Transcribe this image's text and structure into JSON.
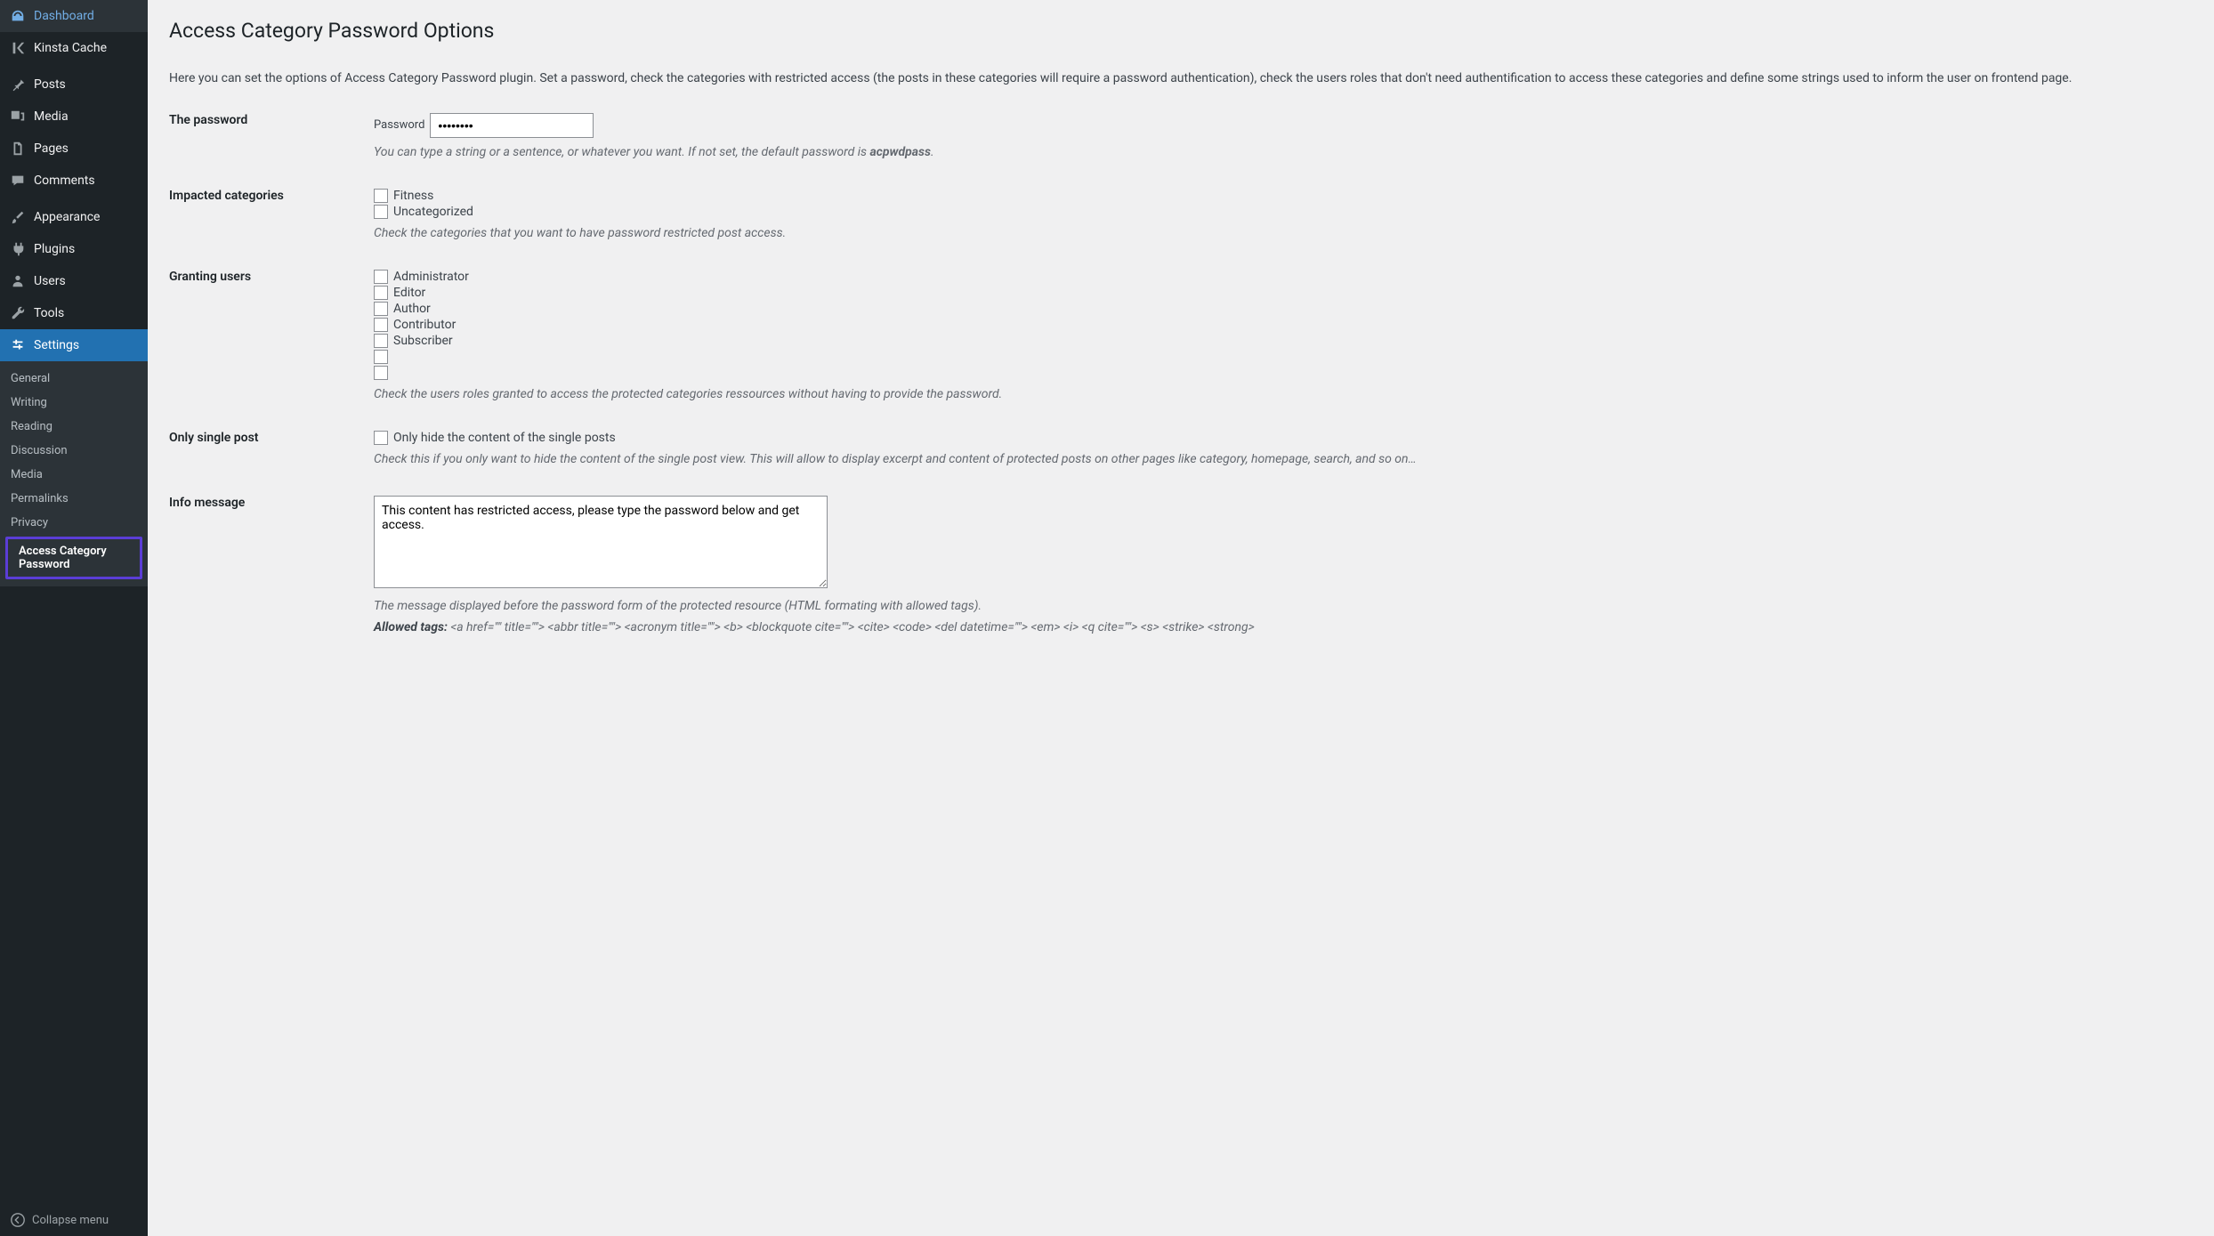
{
  "sidebar": {
    "items": [
      {
        "label": "Dashboard",
        "icon": "dashboard"
      },
      {
        "label": "Kinsta Cache",
        "icon": "kinsta"
      },
      {
        "label": "Posts",
        "icon": "pin"
      },
      {
        "label": "Media",
        "icon": "media"
      },
      {
        "label": "Pages",
        "icon": "pages"
      },
      {
        "label": "Comments",
        "icon": "comments"
      },
      {
        "label": "Appearance",
        "icon": "brush"
      },
      {
        "label": "Plugins",
        "icon": "plug"
      },
      {
        "label": "Users",
        "icon": "user"
      },
      {
        "label": "Tools",
        "icon": "wrench"
      },
      {
        "label": "Settings",
        "icon": "settings",
        "active": true
      }
    ],
    "submenu": [
      {
        "label": "General"
      },
      {
        "label": "Writing"
      },
      {
        "label": "Reading"
      },
      {
        "label": "Discussion"
      },
      {
        "label": "Media"
      },
      {
        "label": "Permalinks"
      },
      {
        "label": "Privacy"
      },
      {
        "label": "Access Category Password",
        "current": true
      }
    ],
    "collapse": "Collapse menu"
  },
  "page": {
    "title": "Access Category Password Options",
    "intro": "Here you can set the options of Access Category Password plugin. Set a password, check the categories with restricted access (the posts in these categories will require a password authentication), check the users roles that don't need authentification to access these categories and define some strings used to inform the user on frontend page.",
    "sections": {
      "password": {
        "heading": "The password",
        "label": "Password",
        "value": "••••••••",
        "help_prefix": "You can type a string or a sentence, or whatever you want. If not set, the default password is ",
        "help_bold": "acpwdpass",
        "help_suffix": "."
      },
      "categories": {
        "heading": "Impacted categories",
        "options": [
          "Fitness",
          "Uncategorized"
        ],
        "help": "Check the categories that you want to have password restricted post access."
      },
      "users": {
        "heading": "Granting users",
        "options": [
          "Administrator",
          "Editor",
          "Author",
          "Contributor",
          "Subscriber",
          "",
          ""
        ],
        "help": "Check the users roles granted to access the protected categories ressources without having to provide the password."
      },
      "single": {
        "heading": "Only single post",
        "option": "Only hide the content of the single posts",
        "help": "Check this if you only want to hide the content of the single post view. This will allow to display excerpt and content of protected posts on other pages like category, homepage, search, and so on…"
      },
      "info": {
        "heading": "Info message",
        "value": "This content has restricted access, please type the password below and get access.",
        "help": "The message displayed before the password form of the protected resource (HTML formating with allowed tags).",
        "allowed_label": "Allowed tags: ",
        "allowed_tags": "<a href=\"\" title=\"\"> <abbr title=\"\"> <acronym title=\"\"> <b> <blockquote cite=\"\"> <cite> <code> <del datetime=\"\"> <em> <i> <q cite=\"\"> <s> <strike> <strong>"
      }
    }
  }
}
